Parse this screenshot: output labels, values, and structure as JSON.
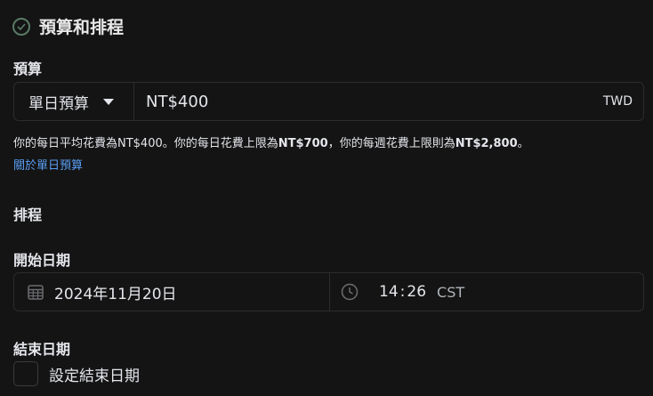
{
  "section": {
    "title": "預算和排程"
  },
  "budget": {
    "label": "預算",
    "type": "單日預算",
    "amount": "NT$400",
    "currency": "TWD",
    "info_1": "你的每日平均花費為NT$400。你的每日花費上限為",
    "info_bold_1": "NT$700",
    "info_2": "，你的每週花費上限則為",
    "info_bold_2": "NT$2,800",
    "info_3": "。",
    "link": "關於單日預算"
  },
  "schedule": {
    "label": "排程",
    "start_label": "開始日期",
    "start_date": "2024年11月20日",
    "start_time_hour": "14",
    "start_time_sep": ":",
    "start_time_min": "26",
    "timezone": "CST",
    "end_label": "結束日期",
    "end_checkbox_label": "設定結束日期"
  },
  "colors": {
    "background": "#141414",
    "border": "#2c2c2c",
    "link": "#5a9ef5",
    "check_icon": "#5a7a66"
  },
  "icons": {
    "section_status": "check-circle-icon",
    "budget_dropdown": "caret-down-icon",
    "date": "calendar-icon",
    "time": "clock-icon"
  }
}
